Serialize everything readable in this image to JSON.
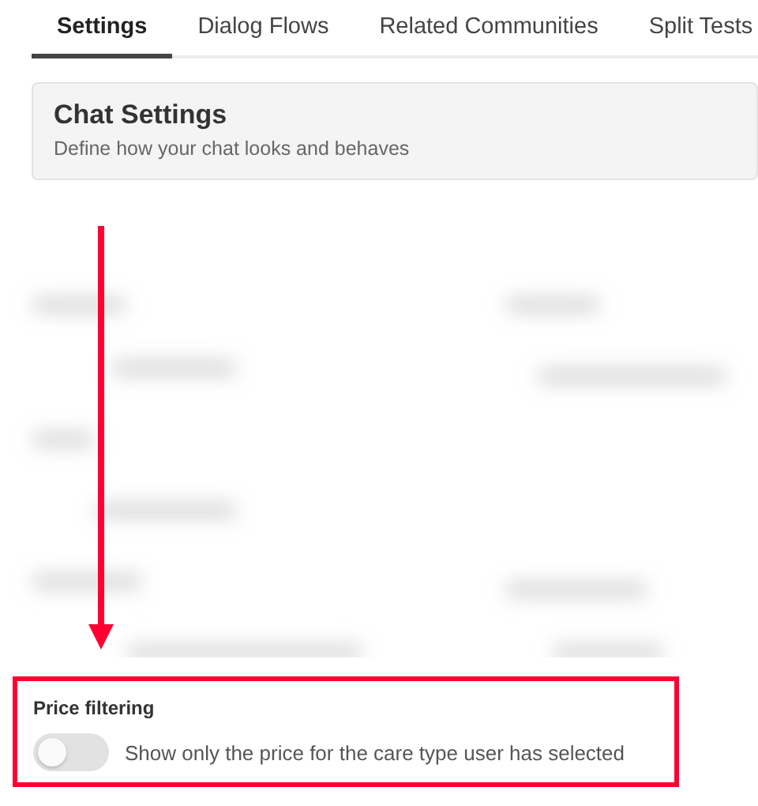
{
  "tabs": [
    {
      "label": "Settings",
      "selected": true
    },
    {
      "label": "Dialog Flows",
      "selected": false
    },
    {
      "label": "Related Communities",
      "selected": false
    },
    {
      "label": "Split Tests",
      "selected": false
    }
  ],
  "header": {
    "title": "Chat Settings",
    "subtitle": "Define how your chat looks and behaves"
  },
  "price_filtering": {
    "label": "Price filtering",
    "toggle": {
      "on": false,
      "label": "Show only the price for the care type user has selected"
    }
  }
}
